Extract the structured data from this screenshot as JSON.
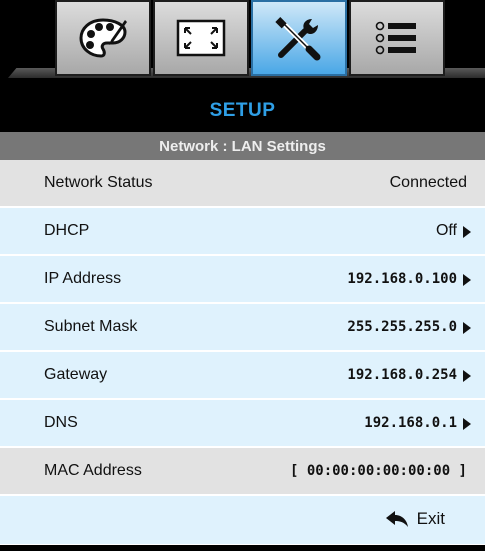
{
  "tabs": [
    {
      "icon": "palette-icon",
      "active": false
    },
    {
      "icon": "screen-resize-icon",
      "active": false
    },
    {
      "icon": "tools-icon",
      "active": true
    },
    {
      "icon": "list-icon",
      "active": false
    }
  ],
  "header": {
    "title": "SETUP"
  },
  "subheader": {
    "title": "Network : LAN Settings"
  },
  "rows": [
    {
      "label": "Network Status",
      "value": "Connected"
    },
    {
      "label": "DHCP",
      "value": "Off"
    },
    {
      "label": "IP Address",
      "value": "192.168.0.100"
    },
    {
      "label": "Subnet Mask",
      "value": "255.255.255.0"
    },
    {
      "label": "Gateway",
      "value": "192.168.0.254"
    },
    {
      "label": "DNS",
      "value": "192.168.0.1"
    },
    {
      "label": "MAC Address",
      "value": "[ 00:00:00:00:00:00 ]"
    }
  ],
  "exit": {
    "label": "Exit",
    "icon": "return-arrow-icon"
  },
  "colors": {
    "accent": "#2f9fe6",
    "row_gray": "#e2e2e2",
    "row_blue": "#dff2fd",
    "subheader": "#777777"
  }
}
